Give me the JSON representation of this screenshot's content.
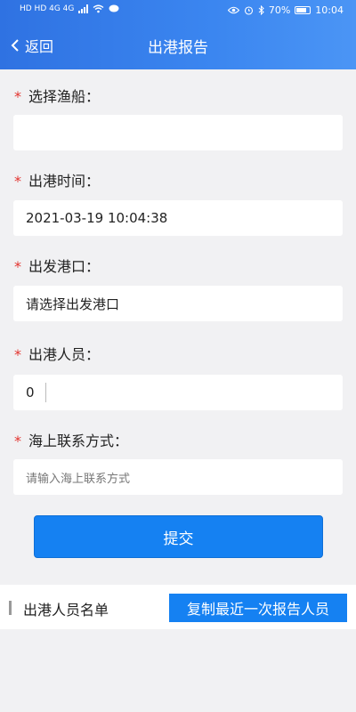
{
  "status_bar": {
    "left_text": "HD HD 4G 4G",
    "battery": "70%",
    "time": "10:04"
  },
  "navbar": {
    "back_label": "返回",
    "title": "出港报告"
  },
  "form": {
    "vessel": {
      "label": "选择渔船：",
      "value": ""
    },
    "departure_time": {
      "label": "出港时间：",
      "value": "2021-03-19 10:04:38"
    },
    "departure_port": {
      "label": "出发港口：",
      "value": "请选择出发港口"
    },
    "crew_count": {
      "label": "出港人员：",
      "value": "0"
    },
    "contact": {
      "label": "海上联系方式：",
      "placeholder": "请输入海上联系方式"
    },
    "required_mark": "*"
  },
  "submit_label": "提交",
  "crew_list": {
    "title": "出港人员名单",
    "copy_button": "复制最近一次报告人员"
  },
  "colors": {
    "header_gradient_start": "#2f72e2",
    "header_gradient_end": "#4b95f5",
    "button_blue": "#1581f2",
    "required_red": "#e3342f",
    "page_bg": "#f1f1f3"
  }
}
